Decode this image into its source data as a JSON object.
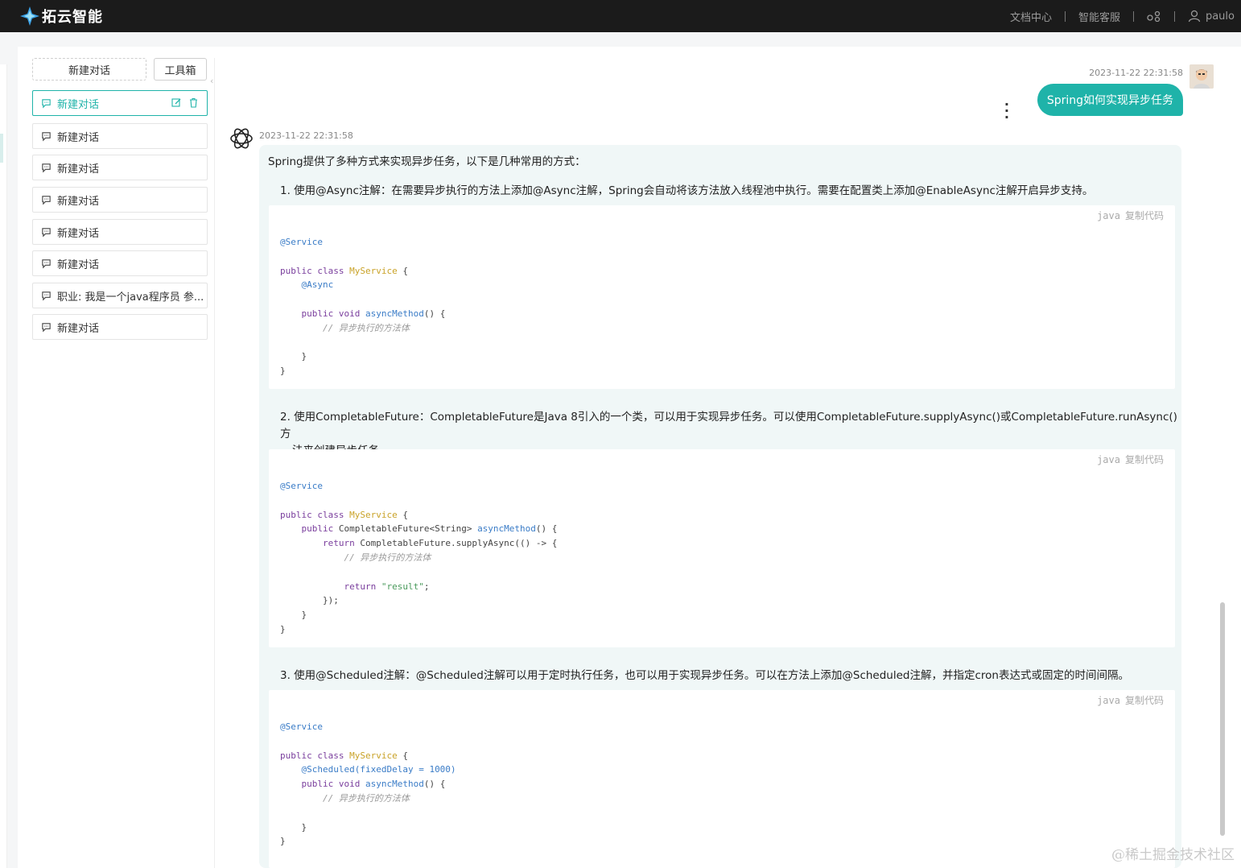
{
  "header": {
    "brand": "拓云智能",
    "nav": [
      "文档中心",
      "智能客服"
    ],
    "username": "paulo"
  },
  "sidebar": {
    "new_chat_button": "新建对话",
    "toolbox_button": "工具箱",
    "conversations": [
      {
        "label": "新建对话",
        "active": true
      },
      {
        "label": "新建对话",
        "active": false
      },
      {
        "label": "新建对话",
        "active": false
      },
      {
        "label": "新建对话",
        "active": false
      },
      {
        "label": "新建对话",
        "active": false
      },
      {
        "label": "新建对话",
        "active": false
      },
      {
        "label": "职业: 我是一个java程序员 参...",
        "active": false
      },
      {
        "label": "新建对话",
        "active": false
      }
    ]
  },
  "chat": {
    "user_message": {
      "time": "2023-11-22 22:31:58",
      "text": "Spring如何实现异步任务"
    },
    "bot_message": {
      "time": "2023-11-22 22:31:58",
      "intro": "Spring提供了多种方式来实现异步任务，以下是几种常用的方式：",
      "point1": "1. 使用@Async注解：在需要异步执行的方法上添加@Async注解，Spring会自动将该方法放入线程池中执行。需要在配置类上添加@EnableAsync注解开启异步支持。",
      "point2a": "2. 使用CompletableFuture：CompletableFuture是Java 8引入的一个类，可以用于实现异步任务。可以使用CompletableFuture.supplyAsync()或CompletableFuture.runAsync()方",
      "point2b": "法来创建异步任务。",
      "point3": "3. 使用@Scheduled注解：@Scheduled注解可以用于定时执行任务，也可以用于实现异步任务。可以在方法上添加@Scheduled注解，并指定cron表达式或固定的时间间隔。",
      "code_lang": "java",
      "copy_label": "复制代码"
    }
  },
  "watermark": "@稀土掘金技术社区",
  "colors": {
    "accent": "#1fb3a9",
    "topbar": "#1b1b1b",
    "bot_bubble": "#f0f7f7"
  }
}
